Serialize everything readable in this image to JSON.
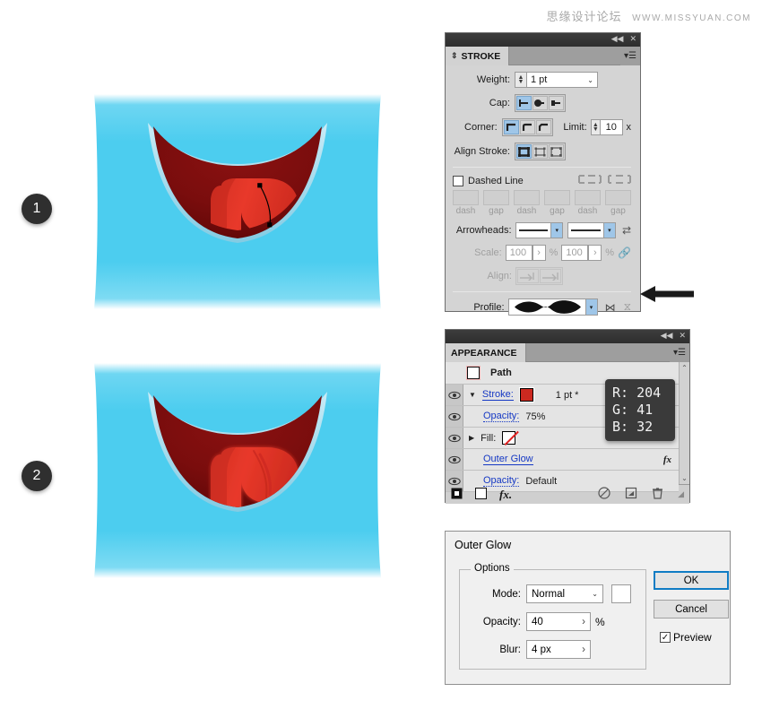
{
  "watermark": {
    "cn": "思缘设计论坛",
    "url": "WWW.MISSYUAN.COM"
  },
  "steps": [
    {
      "number": "1"
    },
    {
      "number": "2"
    }
  ],
  "stroke_panel": {
    "tab_label": "STROKE",
    "weight": {
      "label": "Weight:",
      "value": "1 pt"
    },
    "cap": {
      "label": "Cap:",
      "options": [
        "butt-cap",
        "round-cap",
        "projecting-cap"
      ],
      "selected": 0
    },
    "corner": {
      "label": "Corner:",
      "options": [
        "miter-join",
        "round-join",
        "bevel-join"
      ],
      "selected": 0
    },
    "limit": {
      "label": "Limit:",
      "value": "10",
      "unit": "x"
    },
    "align_stroke": {
      "label": "Align Stroke:",
      "options": [
        "align-center",
        "align-inside",
        "align-outside"
      ],
      "selected": 0
    },
    "dashed_line": {
      "label": "Dashed Line",
      "checked": false
    },
    "dash_fields": [
      {
        "caption": "dash"
      },
      {
        "caption": "gap"
      },
      {
        "caption": "dash"
      },
      {
        "caption": "gap"
      },
      {
        "caption": "dash"
      },
      {
        "caption": "gap"
      }
    ],
    "arrowheads": {
      "label": "Arrowheads:",
      "start": "None",
      "end": "None"
    },
    "scale": {
      "label": "Scale:",
      "start": "100",
      "end": "100",
      "unit": "%"
    },
    "align": {
      "label": "Align:"
    },
    "profile": {
      "label": "Profile:",
      "value": "Width Profile 4"
    }
  },
  "appearance_panel": {
    "tab_label": "APPEARANCE",
    "object_name": "Path",
    "rows": [
      {
        "label": "Stroke:",
        "value": "1 pt *"
      },
      {
        "label": "Opacity:",
        "value": "75%"
      },
      {
        "label": "Fill:",
        "value": ""
      },
      {
        "label": "Outer Glow",
        "value": ""
      },
      {
        "label": "Opacity:",
        "value": "Default"
      }
    ],
    "fx_glyph": "fx"
  },
  "rgb_tooltip": {
    "r": "R: 204",
    "g": "G: 41",
    "b": "B: 32",
    "hex": "#CC2920"
  },
  "outer_glow_dialog": {
    "title": "Outer Glow",
    "options_legend": "Options",
    "mode": {
      "label": "Mode:",
      "value": "Normal"
    },
    "opacity": {
      "label": "Opacity:",
      "value": "40",
      "unit": "%"
    },
    "blur": {
      "label": "Blur:",
      "value": "4 px"
    },
    "ok_label": "OK",
    "cancel_label": "Cancel",
    "preview": {
      "label": "Preview",
      "checked": true,
      "mark": "✓"
    }
  },
  "illustrations": {
    "background_color": "#4CCDEF",
    "mouth_dark": "#7E1010",
    "tongue_color": "#E8392A",
    "rim_color": "#A8DCEC"
  }
}
